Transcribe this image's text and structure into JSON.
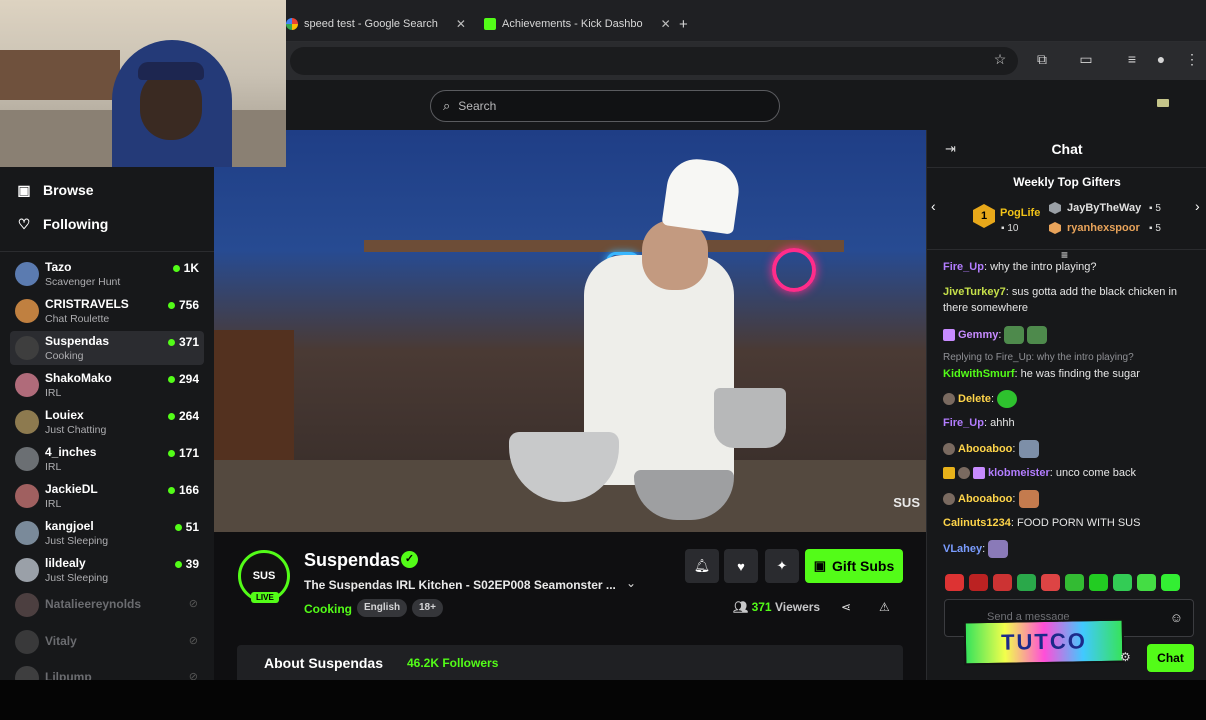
{
  "browser": {
    "tabs": [
      {
        "label": "speed test - Google Search",
        "fav": "#ffffff"
      },
      {
        "label": "Achievements - Kick Dashbo",
        "fav": "#53fc18"
      }
    ]
  },
  "search": {
    "placeholder": "Search"
  },
  "sidebar": {
    "browse": "Browse",
    "following": "Following",
    "channels": [
      {
        "name": "Tazo",
        "category": "Scavenger Hunt",
        "viewers": "1K",
        "color": "#5b7bb0"
      },
      {
        "name": "CRISTRAVELS",
        "category": "Chat Roulette",
        "viewers": "756",
        "color": "#c08040"
      },
      {
        "name": "Suspendas",
        "category": "Cooking",
        "viewers": "371",
        "color": "#3e3e3e"
      },
      {
        "name": "ShakoMako",
        "category": "IRL",
        "viewers": "294",
        "color": "#b06b7a"
      },
      {
        "name": "Louiex",
        "category": "Just Chatting",
        "viewers": "264",
        "color": "#8d7a4f"
      },
      {
        "name": "4_inches",
        "category": "IRL",
        "viewers": "171",
        "color": "#6b6f73"
      },
      {
        "name": "JackieDL",
        "category": "IRL",
        "viewers": "166",
        "color": "#a06060"
      },
      {
        "name": "kangjoel",
        "category": "Just Sleeping",
        "viewers": "51",
        "color": "#7a8a9a"
      },
      {
        "name": "lildealy",
        "category": "Just Sleeping",
        "viewers": "39",
        "color": "#9aa0a8"
      }
    ],
    "offline": [
      {
        "name": "Natalieereynolds",
        "color": "#b08a8a"
      },
      {
        "name": "Vitaly",
        "color": "#777"
      },
      {
        "name": "Lilpump",
        "color": "#888"
      }
    ]
  },
  "stream": {
    "avatar_text": "SUS",
    "live": "LIVE",
    "watermark": "SUS",
    "name": "Suspendas",
    "title": "The Suspendas IRL Kitchen - S02EP008 Seamonster ...",
    "category": "Cooking",
    "tags": [
      "English",
      "18+"
    ],
    "gift_label": "Gift Subs",
    "viewers": "371",
    "viewers_label": "Viewers",
    "about_title": "About Suspendas",
    "followers": "46.2K Followers"
  },
  "chat": {
    "title": "Chat",
    "gifters_title": "Weekly Top Gifters",
    "gifters": [
      {
        "rank": "1",
        "name": "PogLife",
        "count": "10",
        "color": "#f2c318"
      },
      {
        "name": "JayByTheWay",
        "count": "5",
        "color": "#e0e0e0"
      },
      {
        "name": "ryanhexspoor",
        "count": "5",
        "color": "#e8a35a"
      }
    ],
    "messages": [
      {
        "user": "Fire_Up",
        "text": "why the intro playing?",
        "color": "#b37dff"
      },
      {
        "user": "JiveTurkey7",
        "text": "sus gotta add the black chicken in there somewhere",
        "color": "#c6e04a"
      },
      {
        "user": "Gemmy",
        "text": "",
        "color": "#c78bff"
      },
      {
        "reply": "Replying to Fire_Up: why the intro playing?",
        "user": "KidwithSmurf",
        "text": "he was finding the sugar",
        "color": "#53fc18"
      },
      {
        "user": "Delete",
        "text": "",
        "color": "#ffd54a"
      },
      {
        "user": "Fire_Up",
        "text": "ahhh",
        "color": "#b37dff"
      },
      {
        "user": "Abooaboo",
        "text": "",
        "color": "#ffd54a"
      },
      {
        "user": "klobmeister",
        "text": "unco come back",
        "color": "#b37dff"
      },
      {
        "user": "Abooaboo",
        "text": "",
        "color": "#ffd54a"
      },
      {
        "user": "Calinuts1234",
        "text": "FOOD PORN WITH SUS",
        "color": "#ffd54a"
      },
      {
        "user": "VLahey",
        "text": "",
        "color": "#7a9cff"
      }
    ],
    "input_placeholder": "Send a message",
    "send_label": "Chat",
    "sticker_text": "TUTCO"
  }
}
